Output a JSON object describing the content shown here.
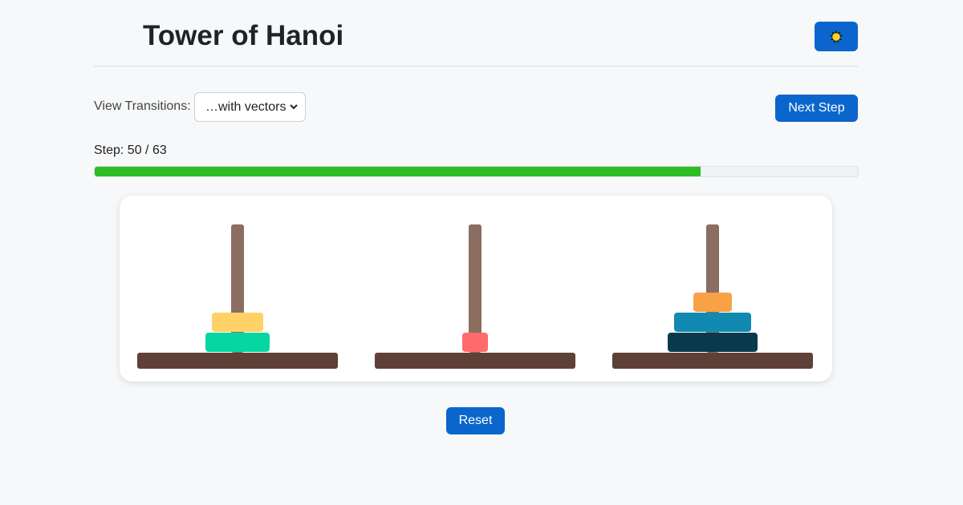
{
  "header": {
    "title": "Tower of Hanoi",
    "theme_toggle_icon": "sun-icon"
  },
  "controls": {
    "view_transitions_label": "View Transitions:",
    "view_transitions_value": "…with vectors",
    "next_step_label": "Next Step"
  },
  "progress": {
    "step_text": "Step: 50 / 63",
    "current": 50,
    "total": 63,
    "fill_color": "#2dbd24"
  },
  "towers": [
    {
      "disks": [
        {
          "size": 5,
          "color": "#06d6a0"
        },
        {
          "size": 4,
          "color": "#ffd166"
        }
      ]
    },
    {
      "disks": [
        {
          "size": 1,
          "color": "#ff6b6b"
        }
      ]
    },
    {
      "disks": [
        {
          "size": 6,
          "color": "#073b4c"
        },
        {
          "size": 3,
          "color": "#118ab2"
        },
        {
          "size": 2,
          "color": "#f8a145"
        }
      ]
    }
  ],
  "reset_label": "Reset",
  "colors": {
    "accent": "#0a66cc",
    "rod": "#8c6d62",
    "base": "#5e4037"
  }
}
